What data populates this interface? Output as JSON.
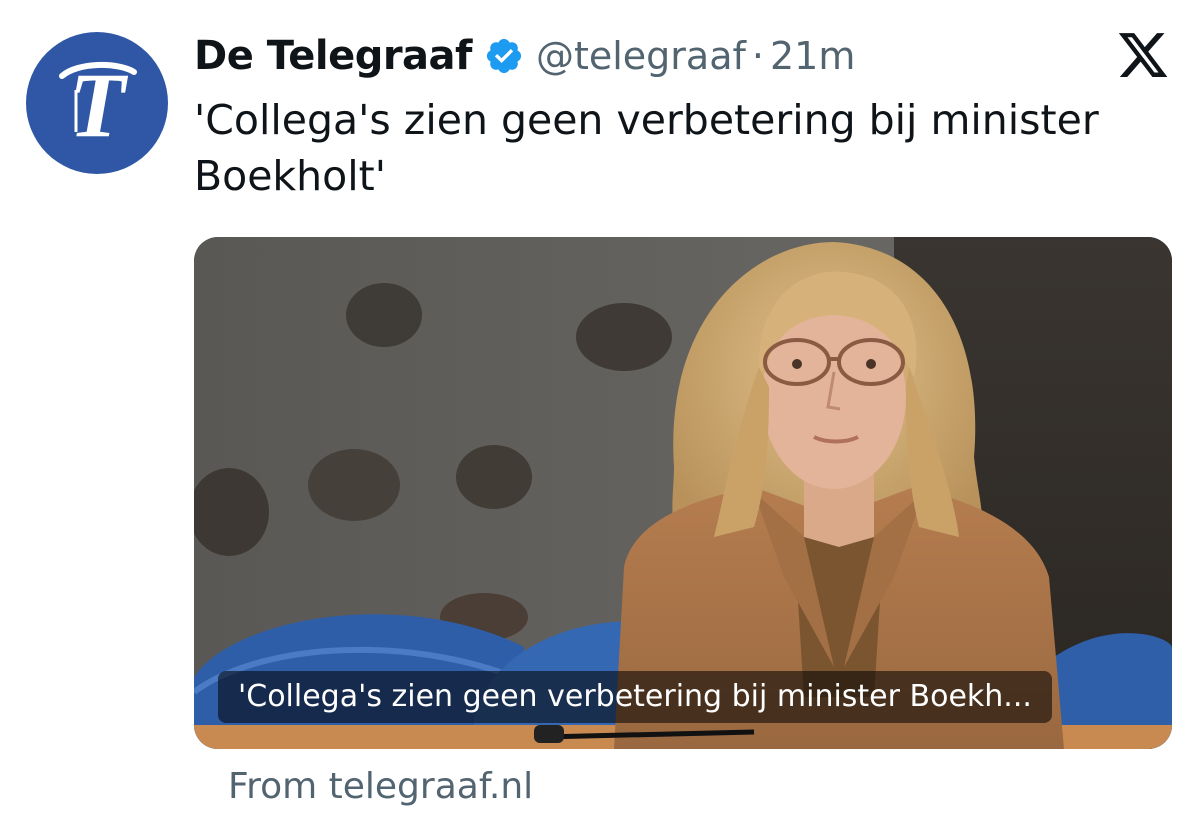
{
  "author": {
    "display_name": "De Telegraaf",
    "handle": "@telegraaf",
    "separator": "·",
    "time": "21m",
    "avatar_icon": "telegraaf-t-logo",
    "avatar_color": "#2f57a6",
    "verified_icon": "verified-badge-icon",
    "verified_color": "#1d9bf0"
  },
  "tweet": {
    "text": "'Collega's zien geen verbetering bij minister Boekholt'"
  },
  "card": {
    "caption": "'Collega's zien geen verbetering bij minister Boekh..."
  },
  "source": {
    "label": "From telegraaf.nl"
  },
  "header_icon": "x-logo-icon"
}
